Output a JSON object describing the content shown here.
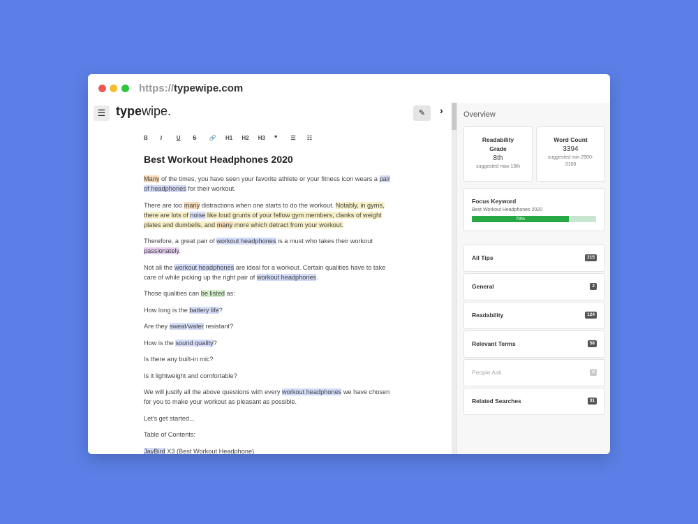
{
  "browser": {
    "url_scheme": "https://",
    "url_host": "typewipe.com"
  },
  "app": {
    "menu_icon": "☰",
    "logo_bold": "type",
    "logo_rest": "wipe.",
    "pen_icon": "✎",
    "collapse_icon": "›"
  },
  "toolbar": [
    "B",
    "I",
    "U",
    "S",
    "🔗",
    "H1",
    "H2",
    "H3",
    "❞",
    "☰",
    "☷"
  ],
  "document": {
    "title": "Best Workout Headphones 2020",
    "p1a": "Many",
    "p1b": " of the times, you have seen your favorite athlete or your fitness icon wears a ",
    "p1c": "pair of headphones",
    "p1d": " for their workout.",
    "p2a": "There are too ",
    "p2b": "many",
    "p2c": " distractions when one starts to do the workout. ",
    "p2d": "Notably, in gyms, there are lots of ",
    "p2e": "noise",
    "p2f": " like loud grunts of your fellow gym members, clanks of weight plates and dumbells, and ",
    "p2g": "many",
    "p2h": " more which detract from your workout.",
    "p3a": "Therefore, a great pair of ",
    "p3b": "workout headphones",
    "p3c": " is a must who takes their workout ",
    "p3d": "passionately",
    "p3e": ".",
    "p4a": "Not all the ",
    "p4b": "workout headphones",
    "p4c": " are ideal for a workout. Certain qualities have to take care of while picking up the right pair of ",
    "p4d": "workout headphones",
    "p4e": ".",
    "p5a": "Those qualities can ",
    "p5b": "be listed",
    "p5c": " as:",
    "p6a": "How long is the ",
    "p6b": "battery life",
    "p6c": "?",
    "p7a": "Are they ",
    "p7b": "sweat",
    "p7c": "/",
    "p7d": "water",
    "p7e": " resistant?",
    "p8a": "How is the ",
    "p8b": "sound quality",
    "p8c": "?",
    "p9": "Is there any built-in mic?",
    "p10": "Is it lightweight and comfortable?",
    "p11a": "We will justify all the above questions with every ",
    "p11b": "workout headphones",
    "p11c": " we have chosen for you to make your workout as pleasant as possible.",
    "p12": "Let's get started...",
    "p13": "Table of Contents:",
    "p14a": "JayBird",
    "p14b": " X3 (Best Workout Headphone)"
  },
  "sidebar": {
    "title": "Overview",
    "readability": {
      "label": "Readability Grade",
      "value": "8th",
      "note": "suggested max 13th"
    },
    "wordcount": {
      "label": "Word Count",
      "value": "3394",
      "note": "suggested min 2900-3100"
    },
    "focus": {
      "label": "Focus Keyword",
      "keyword": "Best Workout Headphones 2020",
      "percent_label": "78%",
      "percent": 0.78
    },
    "tips": [
      {
        "label": "All Tips",
        "count": "215"
      },
      {
        "label": "General",
        "count": "2"
      },
      {
        "label": "Readability",
        "count": "124"
      },
      {
        "label": "Relevant Terms",
        "count": "58"
      },
      {
        "label": "People Ask",
        "count": "0"
      },
      {
        "label": "Related Searches",
        "count": "31"
      }
    ]
  }
}
